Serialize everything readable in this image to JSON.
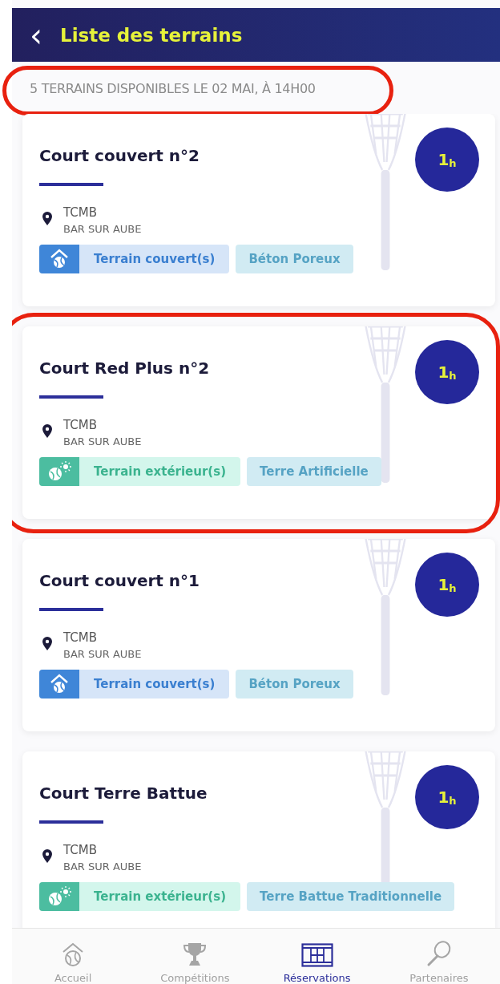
{
  "header": {
    "back": "‹",
    "title": "Liste des terrains"
  },
  "summary": {
    "text": "5 TERRAINS DISPONIBLES LE 02 MAI, À 14H00",
    "highlighted": true
  },
  "courts": [
    {
      "name": "Court couvert n°2",
      "duration": "1",
      "unit": "h",
      "club": "TCMB",
      "city": "BAR SUR AUBE",
      "type": {
        "kind": "indoor",
        "label": "Terrain couvert(s)"
      },
      "surface": "Béton Poreux",
      "highlighted": false
    },
    {
      "name": "Court Red Plus n°2",
      "duration": "1",
      "unit": "h",
      "club": "TCMB",
      "city": "BAR SUR AUBE",
      "type": {
        "kind": "outdoor",
        "label": "Terrain extérieur(s)"
      },
      "surface": "Terre Artificielle",
      "highlighted": true
    },
    {
      "name": "Court couvert n°1",
      "duration": "1",
      "unit": "h",
      "club": "TCMB",
      "city": "BAR SUR AUBE",
      "type": {
        "kind": "indoor",
        "label": "Terrain couvert(s)"
      },
      "surface": "Béton Poreux",
      "highlighted": false
    },
    {
      "name": "Court Terre Battue",
      "duration": "1",
      "unit": "h",
      "club": "TCMB",
      "city": "BAR SUR AUBE",
      "type": {
        "kind": "outdoor",
        "label": "Terrain extérieur(s)"
      },
      "surface": "Terre Battue Traditionnelle",
      "highlighted": false
    }
  ],
  "tabs": [
    {
      "kind": "home",
      "label": "Accueil",
      "selected": false
    },
    {
      "kind": "trophy",
      "label": "Compétitions",
      "selected": false
    },
    {
      "kind": "court",
      "label": "Réservations",
      "selected": true
    },
    {
      "kind": "racket",
      "label": "Partenaires",
      "selected": false
    }
  ]
}
